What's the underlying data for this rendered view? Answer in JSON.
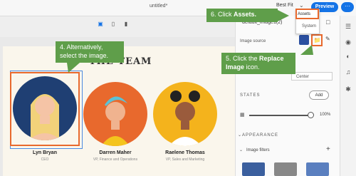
{
  "topbar": {
    "doc_title": "untitled*",
    "fit": "Best Fit",
    "preview": "Preview",
    "more": "···"
  },
  "dropdown": {
    "options": [
      "Assets",
      "System"
    ]
  },
  "panel": {
    "title": "default_image1(2)",
    "image_source": "Image source",
    "align": "Center",
    "states": "STATES",
    "add": "Add",
    "opacity": "100%",
    "appearance": "APPEARANCE",
    "image_filters": "Image filters"
  },
  "page": {
    "heading": "THE TEAM",
    "people": [
      {
        "name": "Lyn Bryan",
        "role": "CEO",
        "color": "#1f3f73",
        "hair": "#f2d27a"
      },
      {
        "name": "Darren Maher",
        "role": "VP, Finance and Operations",
        "color": "#e8692d",
        "hair": "#5bc2d6"
      },
      {
        "name": "Raelene Thomas",
        "role": "VP, Sales and Marketing",
        "color": "#f4b31c",
        "hair": "#222222"
      }
    ]
  },
  "callouts": {
    "step4": "4. Alternatively, select the image.",
    "step5a": "5. Click the ",
    "step5b": "Replace Image",
    "step5c": " icon.",
    "step6a": "6. Click ",
    "step6b": "Assets."
  },
  "colors": {
    "accent": "#1473e6",
    "highlight": "#e8692d",
    "callout": "#5f9e4a"
  }
}
